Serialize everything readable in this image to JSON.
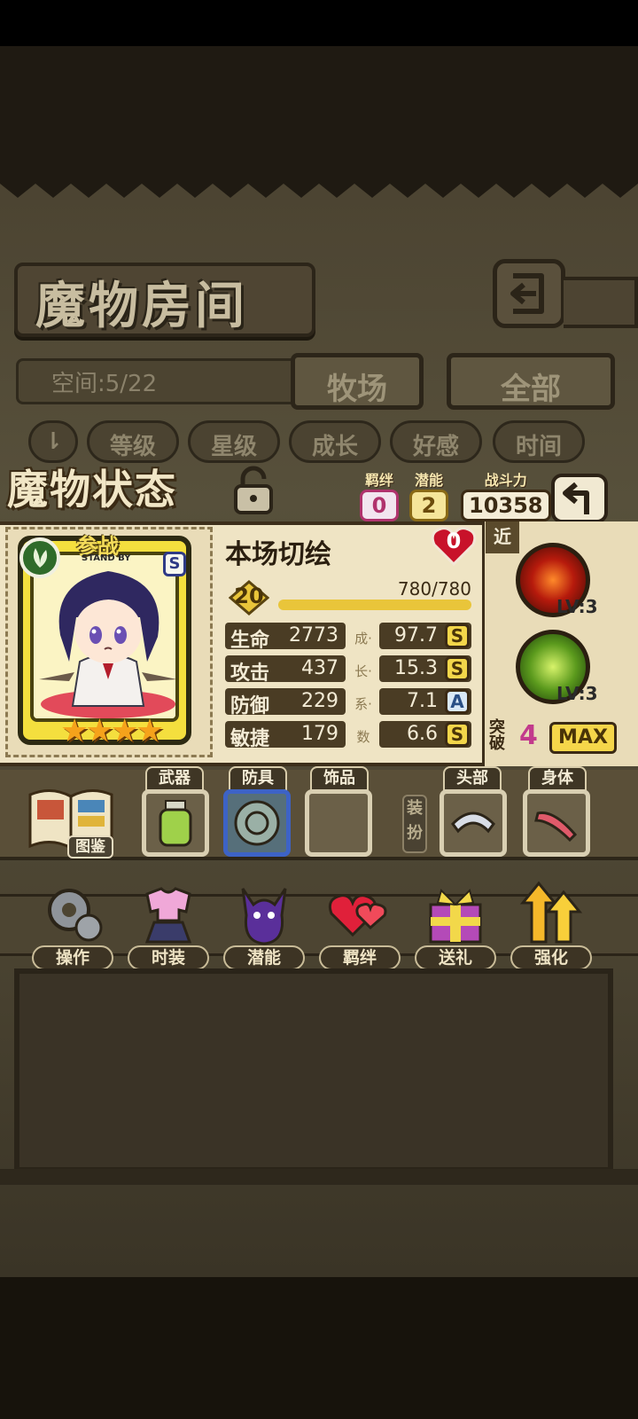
{
  "header": {
    "title": "魔物房间",
    "space": "空间:5/22",
    "tabs": [
      "牧场",
      "全部"
    ]
  },
  "sort": {
    "buttons": [
      "等级",
      "星级",
      "成长",
      "好感",
      "时间"
    ]
  },
  "status": {
    "title": "魔物状态",
    "bond_label": "羁绊",
    "bond_value": "0",
    "potential_label": "潜能",
    "potential_value": "2",
    "power_label": "战斗力",
    "power_value": "10358"
  },
  "monster": {
    "standby": "参战",
    "standby_sub": "STAND BY",
    "rank": "S",
    "stars": "★★★★",
    "name": "本场切绘",
    "hearts": "0",
    "level": "20",
    "hp": "780/780",
    "exp_fraction": 1.0,
    "stats": [
      {
        "label": "生命",
        "value": "2773"
      },
      {
        "label": "攻击",
        "value": "437"
      },
      {
        "label": "防御",
        "value": "229"
      },
      {
        "label": "敏捷",
        "value": "179"
      }
    ],
    "growth_label": "成·长·系·数",
    "growth": [
      {
        "value": "97.7",
        "grade": "S"
      },
      {
        "value": "15.3",
        "grade": "S"
      },
      {
        "value": "7.1",
        "grade": "A"
      },
      {
        "value": "6.6",
        "grade": "S"
      }
    ]
  },
  "skills": {
    "range": "近",
    "items": [
      {
        "level": "LV:3",
        "icon": "slash-skill-icon"
      },
      {
        "level": "LV:3",
        "icon": "drum-skill-icon"
      }
    ],
    "breakthrough_label": "突破",
    "breakthrough_value": "4",
    "max_label": "MAX"
  },
  "equipment": {
    "book_label": "图鉴",
    "slots": [
      "武器",
      "防具",
      "饰品"
    ],
    "pickup_label": "装扮",
    "costume_slots": [
      "头部",
      "身体"
    ]
  },
  "actions": [
    "操作",
    "时装",
    "潜能",
    "羁绊",
    "送礼",
    "强化"
  ]
}
